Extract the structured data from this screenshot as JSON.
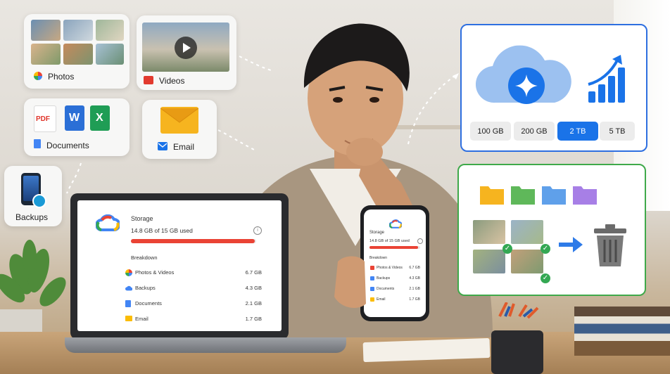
{
  "cards": {
    "photos": "Photos",
    "videos": "Videos",
    "documents": "Documents",
    "email": "Email",
    "backups": "Backups"
  },
  "doc_icons": {
    "pdf": "PDF",
    "word": "W",
    "excel": "X"
  },
  "laptop": {
    "title": "Storage",
    "usage": "14.8 GB of 15 GB used",
    "usage_fraction": 0.987,
    "breakdown_title": "Breakdown",
    "items": [
      {
        "label": "Photos & Videos",
        "value": "6.7 GB",
        "icon": "photos-pinwheel-icon",
        "color": "#ea4335"
      },
      {
        "label": "Backups",
        "value": "4.3 GB",
        "icon": "cloud-icon",
        "color": "#4285f4"
      },
      {
        "label": "Documents",
        "value": "2.1 GB",
        "icon": "document-icon",
        "color": "#4285f4"
      },
      {
        "label": "Email",
        "value": "1.7 GB",
        "icon": "email-icon",
        "color": "#fbbc04"
      }
    ]
  },
  "phone": {
    "title": "Storage",
    "usage": "14.8 GB of 15 GB used",
    "usage_fraction": 0.96,
    "breakdown_title": "Breakdown",
    "items": [
      {
        "label": "Photos & Videos",
        "value": "6.7 GB"
      },
      {
        "label": "Backups",
        "value": "4.3 GB"
      },
      {
        "label": "Documents",
        "value": "2.1 GB"
      },
      {
        "label": "Email",
        "value": "1.7 GB"
      }
    ]
  },
  "plans": [
    "100 GB",
    "200 GB",
    "2 TB",
    "5 TB"
  ],
  "selected_plan": "2 TB",
  "colors": {
    "google_blue": "#1a73e8",
    "usage_red": "#ea4335",
    "cleanup_green": "#3fa94a",
    "upgrade_border": "#2e6fe0"
  }
}
